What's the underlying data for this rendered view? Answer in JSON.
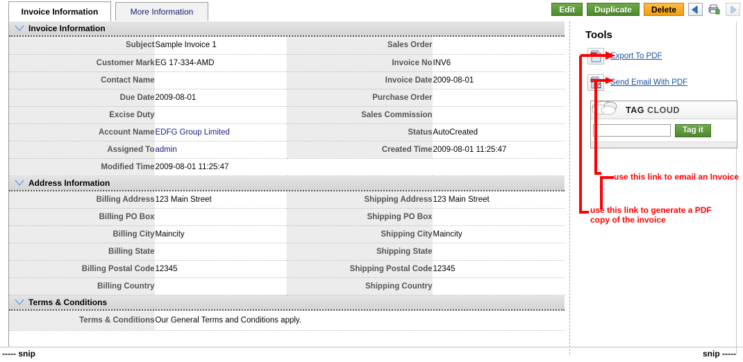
{
  "tabs": [
    {
      "label": "Invoice Information",
      "active": true
    },
    {
      "label": "More Information",
      "active": false
    }
  ],
  "toolbar": {
    "edit_label": "Edit",
    "duplicate_label": "Duplicate",
    "delete_label": "Delete",
    "prev_icon": "previous-record-arrow-icon",
    "print_icon": "printer-icon",
    "next_icon": "next-record-arrow-icon",
    "colors": {
      "green": "#4b8a2b",
      "orange": "#f49c10",
      "link": "#1a4f9c",
      "annotation": "#ff0000"
    }
  },
  "sections": [
    {
      "title": "Invoice Information",
      "rows": [
        {
          "left_label": "Subject",
          "left_value": "Sample Invoice 1",
          "left_link": false,
          "right_label": "Sales Order",
          "right_value": "",
          "right_link": false
        },
        {
          "left_label": "Customer Mark",
          "left_value": "EG 17-334-AMD",
          "left_link": false,
          "right_label": "Invoice No",
          "right_value": "INV6",
          "right_link": false
        },
        {
          "left_label": "Contact Name",
          "left_value": "",
          "left_link": false,
          "right_label": "Invoice Date",
          "right_value": "2009-08-01",
          "right_link": false
        },
        {
          "left_label": "Due Date",
          "left_value": "2009-08-01",
          "left_link": false,
          "right_label": "Purchase Order",
          "right_value": "",
          "right_link": false
        },
        {
          "left_label": "Excise Duty",
          "left_value": "",
          "left_link": false,
          "right_label": "Sales Commission",
          "right_value": "",
          "right_link": false
        },
        {
          "left_label": "Account Name",
          "left_value": "EDFG Group Limited",
          "left_link": true,
          "right_label": "Status",
          "right_value": "AutoCreated",
          "right_link": false
        },
        {
          "left_label": "Assigned To",
          "left_value": "admin",
          "left_link": true,
          "right_label": "Created Time",
          "right_value": "2009-08-01 11:25:47",
          "right_link": false
        },
        {
          "left_label": "Modified Time",
          "left_value": "2009-08-01 11:25:47",
          "left_link": false,
          "right_label": "",
          "right_value": "",
          "right_link": false
        }
      ]
    },
    {
      "title": "Address Information",
      "rows": [
        {
          "left_label": "Billing Address",
          "left_value": "123 Main Street",
          "left_link": false,
          "right_label": "Shipping Address",
          "right_value": "123 Main Street",
          "right_link": false
        },
        {
          "left_label": "Billing PO Box",
          "left_value": "",
          "left_link": false,
          "right_label": "Shipping PO Box",
          "right_value": "",
          "right_link": false
        },
        {
          "left_label": "Billing City",
          "left_value": "Maincity",
          "left_link": false,
          "right_label": "Shipping City",
          "right_value": "Maincity",
          "right_link": false
        },
        {
          "left_label": "Billing State",
          "left_value": "",
          "left_link": false,
          "right_label": "Shipping State",
          "right_value": "",
          "right_link": false
        },
        {
          "left_label": "Billing Postal Code",
          "left_value": "12345",
          "left_link": false,
          "right_label": "Shipping Postal Code",
          "right_value": "12345",
          "right_link": false
        },
        {
          "left_label": "Billing Country",
          "left_value": "",
          "left_link": false,
          "right_label": "Shipping Country",
          "right_value": "",
          "right_link": false
        }
      ]
    }
  ],
  "terms_section": {
    "title": "Terms & Conditions",
    "label": "Terms & Conditions",
    "value": "Our General Terms and Conditions apply."
  },
  "tools": {
    "title": "Tools",
    "export_pdf_label": "Export To PDF",
    "export_pdf_icon": "pdf-document-icon",
    "send_email_pdf_label": "Send Email With PDF",
    "send_email_pdf_icon": "pdf-email-icon",
    "tag_cloud": {
      "title_word1": "TAG",
      "title_word2": "CLOUD",
      "cloud_icon": "cloud-icon",
      "input_value": "",
      "input_placeholder": "",
      "button_label": "Tag it"
    }
  },
  "annotations": [
    {
      "text": "use this link to email an Invoice"
    },
    {
      "text": "use this link to generate a PDF\ncopy of the invoice"
    }
  ],
  "snip": {
    "left": "----- snip",
    "right": "snip -----"
  }
}
